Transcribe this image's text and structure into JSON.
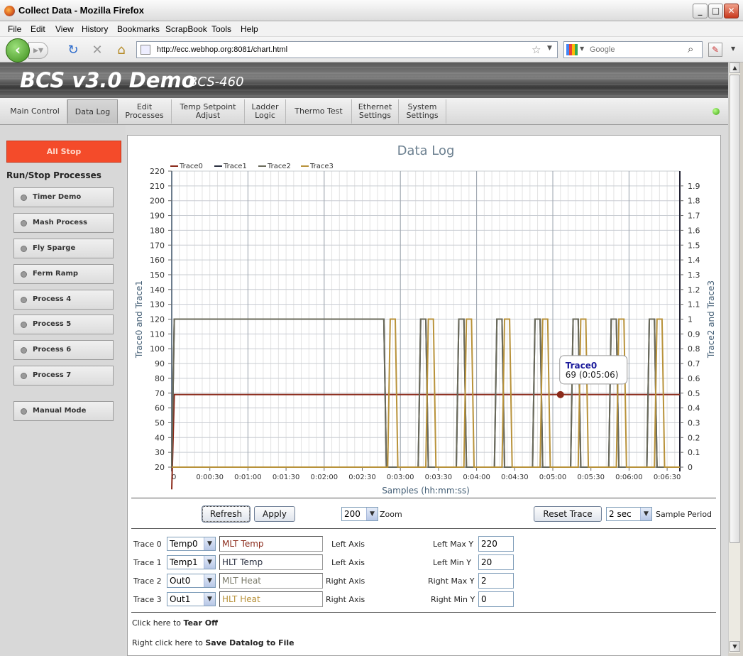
{
  "window": {
    "title": "Collect Data - Mozilla Firefox",
    "min": "_",
    "max": "□",
    "close": "✕"
  },
  "menu": [
    "File",
    "Edit",
    "View",
    "History",
    "Bookmarks",
    "ScrapBook",
    "Tools",
    "Help"
  ],
  "nav": {
    "url": "http://ecc.webhop.org:8081/chart.html",
    "search_placeholder": "Google"
  },
  "header": {
    "title": "BCS v3.0 Demo",
    "model": "BCS-460"
  },
  "tabs": [
    {
      "label": "Main Control"
    },
    {
      "label": "Data Log"
    },
    {
      "label": "Edit\nProcesses"
    },
    {
      "label": "Temp Setpoint\nAdjust"
    },
    {
      "label": "Ladder\nLogic"
    },
    {
      "label": "Thermo Test"
    },
    {
      "label": "Ethernet\nSettings"
    },
    {
      "label": "System\nSettings"
    }
  ],
  "sidebar": {
    "all_stop": "All Stop",
    "run_stop_title": "Run/Stop Processes",
    "processes": [
      "Timer Demo",
      "Mash Process",
      "Fly Sparge",
      "Ferm Ramp",
      "Process 4",
      "Process 5",
      "Process 6",
      "Process 7"
    ],
    "manual_mode": "Manual Mode"
  },
  "chart_data": {
    "type": "line",
    "title": "Data Log",
    "xlabel": "Samples (hh:mm:ss)",
    "ylabel_left": "Trace0 and Trace1",
    "ylabel_right": "Trace2 and Trace3",
    "ylim_left": [
      20,
      220
    ],
    "ylim_right": [
      0,
      2
    ],
    "y_ticks_left": [
      20,
      30,
      40,
      50,
      60,
      70,
      80,
      90,
      100,
      110,
      120,
      130,
      140,
      150,
      160,
      170,
      180,
      190,
      200,
      210,
      220
    ],
    "y_ticks_right": [
      "0",
      "0.1",
      "0.2",
      "0.3",
      "0.4",
      "0.5",
      "0.6",
      "0.7",
      "0.8",
      "0.9",
      "1",
      "1.1",
      "1.2",
      "1.3",
      "1.4",
      "1.5",
      "1.6",
      "1.7",
      "1.8",
      "1.9"
    ],
    "x_ticks": [
      "0",
      "0:00:30",
      "0:01:00",
      "0:01:30",
      "0:02:00",
      "0:02:30",
      "0:03:00",
      "0:03:30",
      "0:04:00",
      "0:04:30",
      "0:05:00",
      "0:05:30",
      "0:06:00",
      "0:06:30"
    ],
    "xlim_sec": [
      0,
      400
    ],
    "grid": true,
    "legend_position": "top-left",
    "series": [
      {
        "name": "Trace0",
        "color": "#8b2a1a",
        "axis": "left",
        "points": [
          [
            0,
            5
          ],
          [
            2,
            69
          ],
          [
            400,
            69
          ]
        ]
      },
      {
        "name": "Trace1",
        "color": "#2a3040",
        "axis": "left",
        "points": [
          [
            0,
            20
          ],
          [
            2,
            120
          ],
          [
            167,
            120
          ],
          [
            169,
            20
          ],
          [
            194,
            20
          ],
          [
            196,
            120
          ],
          [
            200,
            120
          ],
          [
            202,
            20
          ],
          [
            224,
            20
          ],
          [
            226,
            120
          ],
          [
            230,
            120
          ],
          [
            232,
            20
          ],
          [
            254,
            20
          ],
          [
            256,
            120
          ],
          [
            260,
            120
          ],
          [
            262,
            20
          ],
          [
            284,
            20
          ],
          [
            286,
            120
          ],
          [
            290,
            120
          ],
          [
            292,
            20
          ],
          [
            314,
            20
          ],
          [
            316,
            120
          ],
          [
            320,
            120
          ],
          [
            322,
            20
          ],
          [
            344,
            20
          ],
          [
            346,
            120
          ],
          [
            350,
            120
          ],
          [
            352,
            20
          ],
          [
            374,
            20
          ],
          [
            376,
            120
          ],
          [
            380,
            120
          ],
          [
            382,
            20
          ],
          [
            400,
            20
          ]
        ]
      },
      {
        "name": "Trace2",
        "color": "#6a6a5a",
        "axis": "right",
        "points": [
          [
            0,
            0
          ],
          [
            2,
            1
          ],
          [
            167,
            1
          ],
          [
            169,
            0
          ],
          [
            194,
            0
          ],
          [
            196,
            1
          ],
          [
            200,
            1
          ],
          [
            202,
            0
          ],
          [
            224,
            0
          ],
          [
            226,
            1
          ],
          [
            230,
            1
          ],
          [
            232,
            0
          ],
          [
            254,
            0
          ],
          [
            256,
            1
          ],
          [
            260,
            1
          ],
          [
            262,
            0
          ],
          [
            284,
            0
          ],
          [
            286,
            1
          ],
          [
            290,
            1
          ],
          [
            292,
            0
          ],
          [
            314,
            0
          ],
          [
            316,
            1
          ],
          [
            320,
            1
          ],
          [
            322,
            0
          ],
          [
            344,
            0
          ],
          [
            346,
            1
          ],
          [
            350,
            1
          ],
          [
            352,
            0
          ],
          [
            374,
            0
          ],
          [
            376,
            1
          ],
          [
            380,
            1
          ],
          [
            382,
            0
          ],
          [
            400,
            0
          ]
        ]
      },
      {
        "name": "Trace3",
        "color": "#b8923a",
        "axis": "right",
        "points": [
          [
            0,
            0
          ],
          [
            169,
            0
          ],
          [
            170,
            0
          ],
          [
            172,
            1
          ],
          [
            176,
            1
          ],
          [
            178,
            0
          ],
          [
            200,
            0
          ],
          [
            202,
            1
          ],
          [
            206,
            1
          ],
          [
            208,
            0
          ],
          [
            230,
            0
          ],
          [
            232,
            1
          ],
          [
            236,
            1
          ],
          [
            238,
            0
          ],
          [
            260,
            0
          ],
          [
            262,
            1
          ],
          [
            266,
            1
          ],
          [
            268,
            0
          ],
          [
            290,
            0
          ],
          [
            292,
            1
          ],
          [
            296,
            1
          ],
          [
            298,
            0
          ],
          [
            320,
            0
          ],
          [
            322,
            1
          ],
          [
            326,
            1
          ],
          [
            328,
            0
          ],
          [
            350,
            0
          ],
          [
            352,
            1
          ],
          [
            356,
            1
          ],
          [
            358,
            0
          ],
          [
            380,
            0
          ],
          [
            382,
            1
          ],
          [
            386,
            1
          ],
          [
            388,
            0
          ],
          [
            400,
            0
          ]
        ]
      }
    ],
    "tooltip": {
      "series": "Trace0",
      "text": "69 (0:05:06)",
      "x_sec": 306,
      "y": 69
    }
  },
  "controls": {
    "refresh": "Refresh",
    "apply": "Apply",
    "zoom_value": "200",
    "zoom_label": "Zoom",
    "reset_trace": "Reset Trace",
    "sample_period_value": "2 sec",
    "sample_period_label": "Sample Period"
  },
  "traces": [
    {
      "label": "Trace 0",
      "source": "Temp0",
      "name": "MLT Temp",
      "axis": "Left Axis",
      "limit_label": "Left Max Y",
      "limit_value": "220",
      "color": "#8b2a1a"
    },
    {
      "label": "Trace 1",
      "source": "Temp1",
      "name": "HLT Temp",
      "axis": "Left Axis",
      "limit_label": "Left Min Y",
      "limit_value": "20",
      "color": "#2a3040"
    },
    {
      "label": "Trace 2",
      "source": "Out0",
      "name": "MLT Heat",
      "axis": "Right Axis",
      "limit_label": "Right Max Y",
      "limit_value": "2",
      "color": "#7a7a6a"
    },
    {
      "label": "Trace 3",
      "source": "Out1",
      "name": "HLT Heat",
      "axis": "Right Axis",
      "limit_label": "Right Min Y",
      "limit_value": "0",
      "color": "#b8923a"
    }
  ],
  "footer": {
    "tear_prefix": "Click here to ",
    "tear_bold": "Tear Off",
    "save_prefix": "Right click here to ",
    "save_bold": "Save Datalog to File"
  }
}
